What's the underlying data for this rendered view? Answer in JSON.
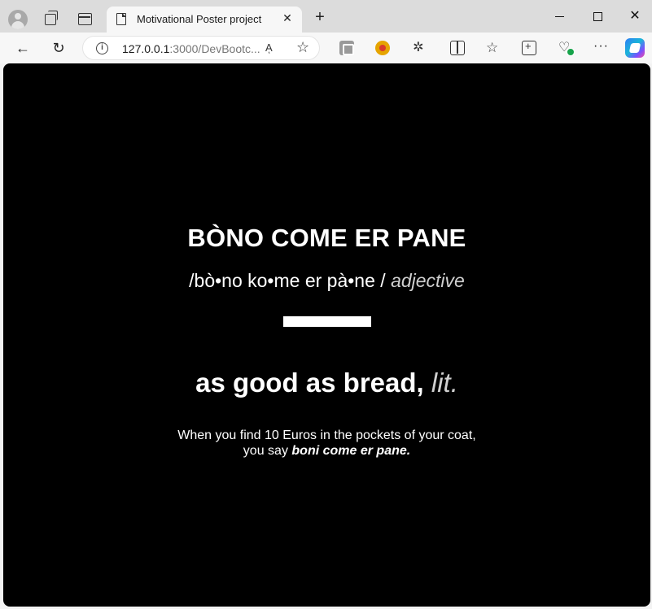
{
  "browser": {
    "tab": {
      "title": "Motivational Poster project",
      "close_glyph": "✕"
    },
    "new_tab_glyph": "+",
    "window_controls": {
      "close_glyph": "✕"
    },
    "nav": {
      "back_glyph": "←",
      "reload_glyph": "↻"
    },
    "address": {
      "host": "127.0.0.1",
      "rest": ":3000/DevBootc...",
      "read_aloud_glyph": "Aͅ",
      "favorite_glyph": "☆"
    },
    "toolbar": {
      "puzzle_glyph": "✲",
      "favorites_glyph": "☆",
      "health_glyph": "♡",
      "more_glyph": "···"
    }
  },
  "poster": {
    "headword": "BÒNO COME ER PANE",
    "pronunciation": "/bò•no ko•me er pà•ne /",
    "part_of_speech": "adjective",
    "translation": "as good as bread,",
    "translation_note": "lit.",
    "example_line1": "When you find 10 Euros in the pockets of your coat,",
    "example_line2_prefix": "you say",
    "example_line2_emphasis": "boni come er pane."
  }
}
